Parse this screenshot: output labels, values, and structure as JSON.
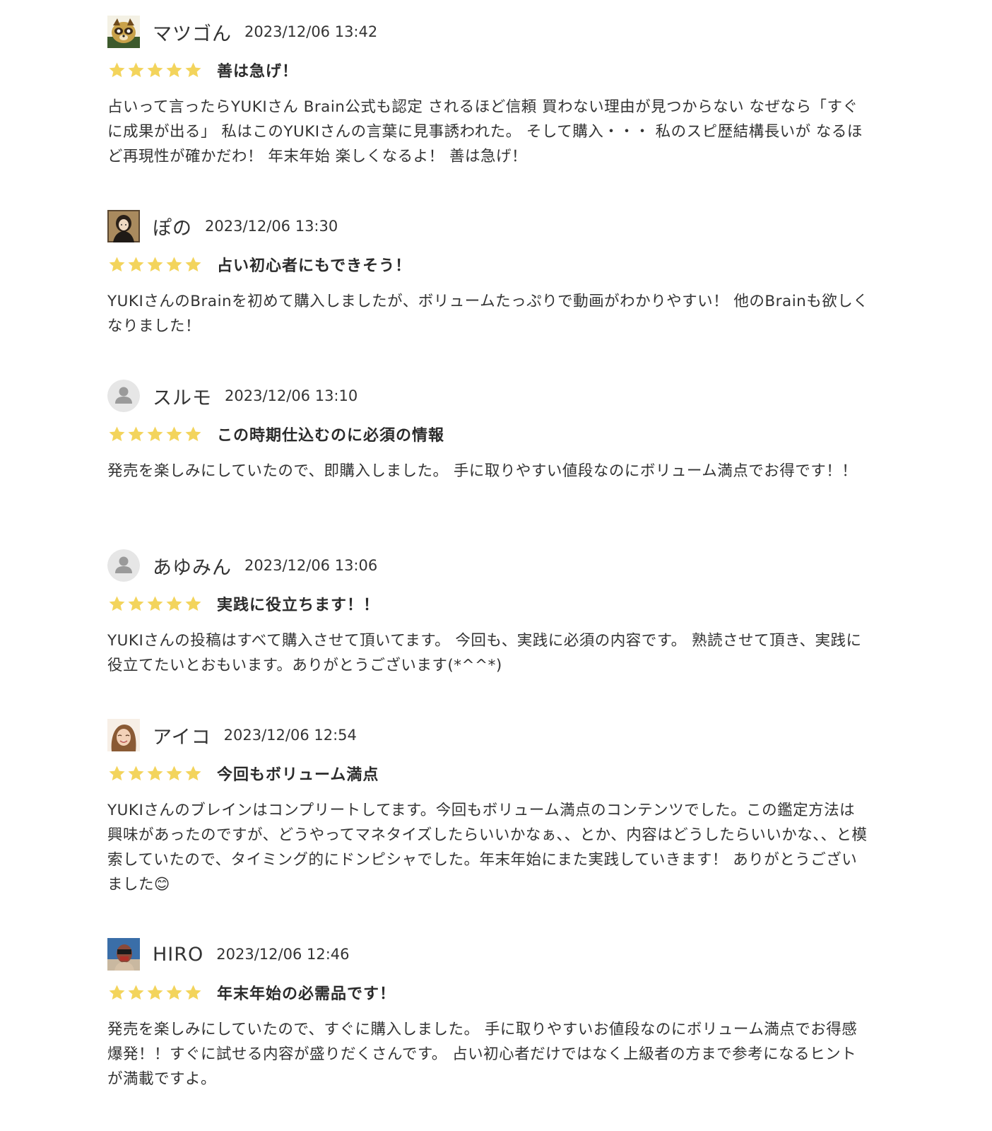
{
  "reviews": [
    {
      "user": "マツゴん",
      "date": "2023/12/06 13:42",
      "rating": 5,
      "avatar": "tanuki-mascot-avatar",
      "title": "善は急げ！",
      "body": "占いって言ったらYUKIさん Brain公式も認定 されるほど信頼 買わない理由が見つからない なぜなら「すぐに成果が出る」 私はこのYUKIさんの言葉に見事誘われた。 そして購入・・・ 私のスピ歴結構長いが なるほど再現性が確かだわ！ 年末年始 楽しくなるよ！ 善は急げ！"
    },
    {
      "user": "ぽの",
      "date": "2023/12/06 13:30",
      "rating": 5,
      "avatar": "portrait-avatar",
      "title": "占い初心者にもできそう！",
      "body": "YUKIさんのBrainを初めて購入しましたが、ボリュームたっぷりで動画がわかりやすい！ 他のBrainも欲しくなりました！"
    },
    {
      "user": "スルモ",
      "date": "2023/12/06 13:10",
      "rating": 5,
      "avatar": "default-user-avatar",
      "title": "この時期仕込むのに必須の情報",
      "body": "発売を楽しみにしていたので、即購入しました。 手に取りやすい値段なのにボリューム満点でお得です！！"
    },
    {
      "user": "あゆみん",
      "date": "2023/12/06 13:06",
      "rating": 5,
      "avatar": "default-user-avatar",
      "title": "実践に役立ちます！！",
      "body": "YUKIさんの投稿はすべて購入させて頂いてます。 今回も、実践に必須の内容です。 熟読させて頂き、実践に役立てたいとおもいます。ありがとうございます(*^^*)"
    },
    {
      "user": "アイコ",
      "date": "2023/12/06 12:54",
      "rating": 5,
      "avatar": "smiling-woman-avatar",
      "title": "今回もボリューム満点",
      "body": "YUKIさんのブレインはコンプリートしてます。今回もボリューム満点のコンテンツでした。この鑑定方法は興味があったのですが、どうやってマネタイズしたらいいかなぁ、、とか、内容はどうしたらいいかな、、と模索していたので、タイミング的にドンピシャでした。年末年始にまた実践していきます！ ありがとうございました😊"
    },
    {
      "user": "HIRO",
      "date": "2023/12/06 12:46",
      "rating": 5,
      "avatar": "photo-avatar",
      "title": "年末年始の必需品です！",
      "body": "発売を楽しみにしていたので、すぐに購入しました。 手に取りやすいお値段なのにボリューム満点でお得感爆発！！すぐに試せる内容が盛りだくさんです。 占い初心者だけではなく上級者の方まで参考になるヒントが満載ですよ。"
    }
  ],
  "colors": {
    "star": "#f3d45c",
    "text": "#333333",
    "default_avatar_bg": "#e6e6e6",
    "default_avatar_fg": "#9a9a9a"
  }
}
